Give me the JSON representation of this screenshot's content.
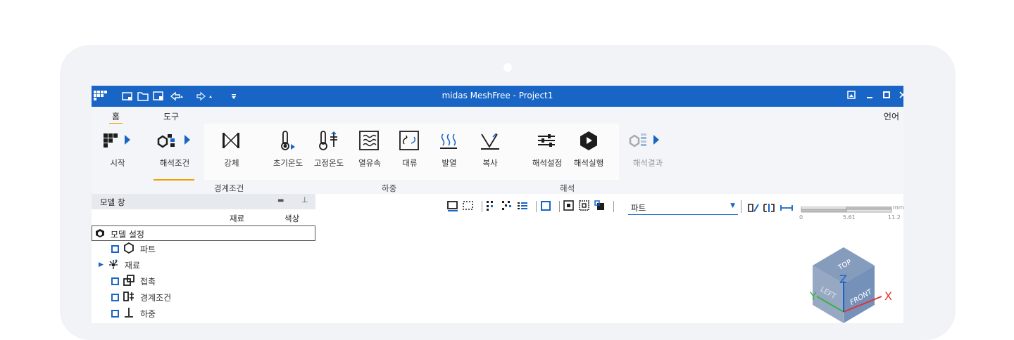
{
  "app": {
    "title": "midas MeshFree - Project1"
  },
  "tabs": [
    {
      "label": "홈"
    },
    {
      "label": "도구"
    }
  ],
  "language": "언어",
  "ribbon": {
    "start": "시작",
    "analysis_condition": "해석조건",
    "rigid": "강체",
    "initial_temp": "초기온도",
    "fixed_temp": "고정온도",
    "heat_flux": "열유속",
    "convection": "대류",
    "heat_gen": "발열",
    "radiation": "복사",
    "analysis_settings": "해석설정",
    "run_analysis": "해석실행",
    "analysis_results": "해석결과",
    "group_boundary": "경계조건",
    "group_load": "하중",
    "group_analysis": "해석"
  },
  "panel": {
    "title": "모델 창",
    "col_material": "재료",
    "col_color": "색상",
    "root": "모델 설정",
    "items": [
      "파트",
      "재료",
      "접촉",
      "경계조건",
      "하중"
    ]
  },
  "viewport": {
    "combo_value": "파트",
    "scale_unit": "mm",
    "scale_ticks": [
      "0",
      "5.61",
      "11.2"
    ],
    "cube": {
      "top": "TOP",
      "front": "FRONT",
      "left": "LEFT",
      "x": "X",
      "y": "Y",
      "z": "Z"
    }
  },
  "colors": {
    "accent": "#1865c5",
    "tab_underline": "#f0a000",
    "device": "#f1f3f7"
  }
}
